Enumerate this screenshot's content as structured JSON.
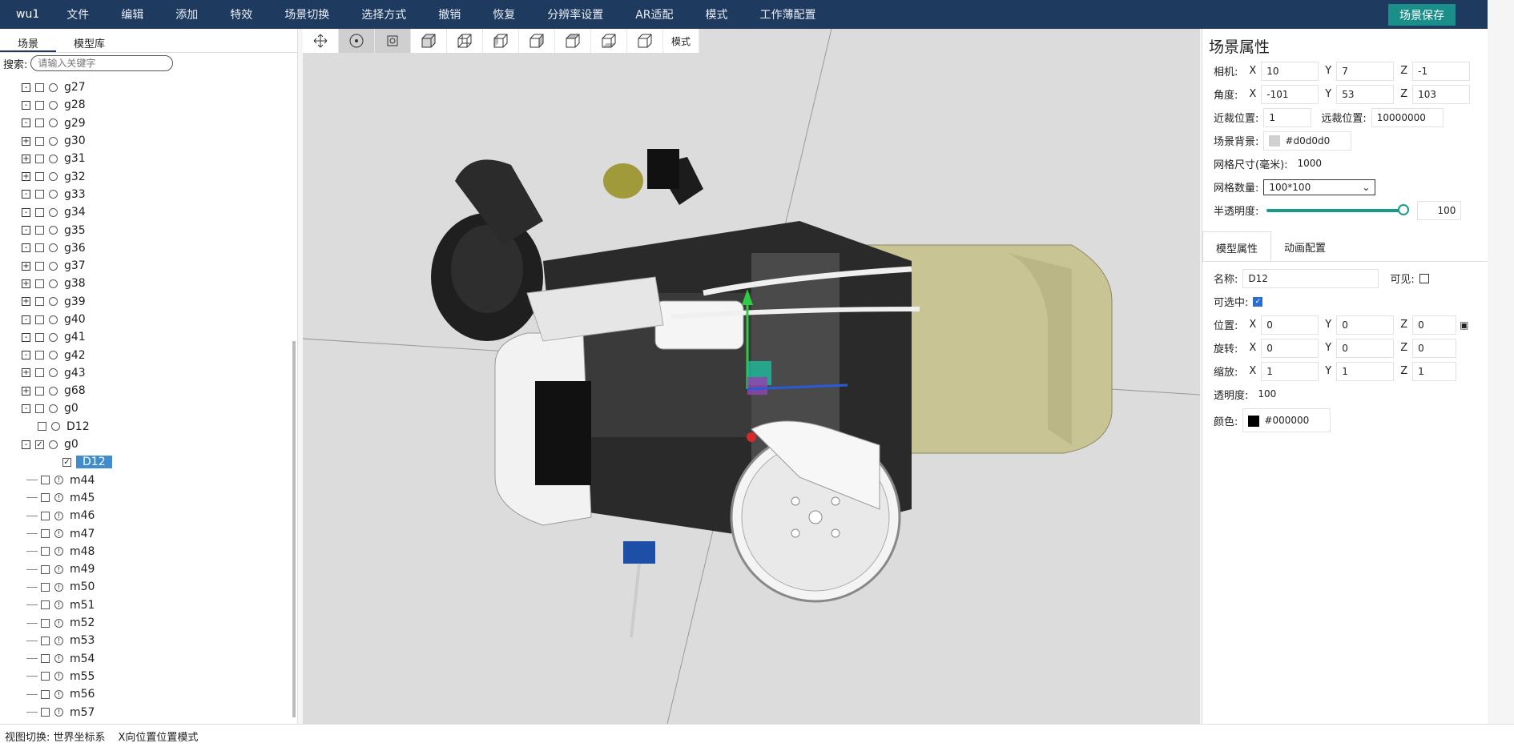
{
  "app": {
    "name": "wu1"
  },
  "menu": {
    "items": [
      "文件",
      "编辑",
      "添加",
      "特效",
      "场景切换",
      "选择方式",
      "撤销",
      "恢复",
      "分辨率设置",
      "AR适配",
      "模式",
      "工作薄配置"
    ],
    "save_label": "场景保存"
  },
  "left": {
    "tabs": [
      "场景",
      "模型库"
    ],
    "search": {
      "label": "搜索:",
      "placeholder": "请输入关键字"
    },
    "tree": [
      {
        "label": "g27",
        "kind": "group",
        "expand": "-"
      },
      {
        "label": "g28",
        "kind": "group",
        "expand": "-"
      },
      {
        "label": "g29",
        "kind": "group",
        "expand": "-"
      },
      {
        "label": "g30",
        "kind": "group",
        "expand": "+"
      },
      {
        "label": "g31",
        "kind": "group",
        "expand": "+"
      },
      {
        "label": "g32",
        "kind": "group",
        "expand": "+"
      },
      {
        "label": "g33",
        "kind": "group",
        "expand": "-"
      },
      {
        "label": "g34",
        "kind": "group",
        "expand": "-"
      },
      {
        "label": "g35",
        "kind": "group",
        "expand": "-"
      },
      {
        "label": "g36",
        "kind": "group",
        "expand": "-"
      },
      {
        "label": "g37",
        "kind": "group",
        "expand": "+"
      },
      {
        "label": "g38",
        "kind": "group",
        "expand": "+"
      },
      {
        "label": "g39",
        "kind": "group",
        "expand": "+"
      },
      {
        "label": "g40",
        "kind": "group",
        "expand": "-"
      },
      {
        "label": "g41",
        "kind": "group",
        "expand": "-"
      },
      {
        "label": "g42",
        "kind": "group",
        "expand": "-"
      },
      {
        "label": "g43",
        "kind": "group",
        "expand": "+"
      },
      {
        "label": "g68",
        "kind": "group",
        "expand": "+"
      },
      {
        "label": "g0",
        "kind": "group",
        "expand": "-"
      },
      {
        "label": "D12",
        "kind": "child"
      },
      {
        "label": "g0",
        "kind": "group",
        "expand": "-",
        "checked": true
      },
      {
        "label": "D12",
        "kind": "child",
        "selected": true,
        "checked": true
      },
      {
        "label": "m44",
        "kind": "mesh"
      },
      {
        "label": "m45",
        "kind": "mesh"
      },
      {
        "label": "m46",
        "kind": "mesh"
      },
      {
        "label": "m47",
        "kind": "mesh"
      },
      {
        "label": "m48",
        "kind": "mesh"
      },
      {
        "label": "m49",
        "kind": "mesh"
      },
      {
        "label": "m50",
        "kind": "mesh"
      },
      {
        "label": "m51",
        "kind": "mesh"
      },
      {
        "label": "m52",
        "kind": "mesh"
      },
      {
        "label": "m53",
        "kind": "mesh"
      },
      {
        "label": "m54",
        "kind": "mesh"
      },
      {
        "label": "m55",
        "kind": "mesh"
      },
      {
        "label": "m56",
        "kind": "mesh"
      },
      {
        "label": "m57",
        "kind": "mesh"
      }
    ]
  },
  "toolbar": {
    "icons": [
      "move-icon",
      "rotate-icon",
      "scale-icon",
      "view-front-icon",
      "view-back-icon",
      "view-left-icon",
      "view-right-icon",
      "view-top-icon",
      "view-bottom-icon"
    ],
    "mode_label": "模式"
  },
  "right": {
    "title": "场景属性",
    "camera": {
      "label": "相机:",
      "x": "10",
      "y": "7",
      "z": "-1"
    },
    "angle": {
      "label": "角度:",
      "x": "-101",
      "y": "53",
      "z": "103"
    },
    "near": {
      "label": "近裁位置:",
      "value": "1"
    },
    "far": {
      "label": "远裁位置:",
      "value": "10000000"
    },
    "bg": {
      "label": "场景背景:",
      "value": "#d0d0d0",
      "color": "#d0d0d0"
    },
    "grid_size": {
      "label": "网格尺寸(毫米):",
      "value": "1000"
    },
    "grid_count": {
      "label": "网格数量:",
      "value": "100*100"
    },
    "opacity_scene": {
      "label": "半透明度:",
      "value": "100",
      "level": 1.0
    },
    "tabs": [
      "模型属性",
      "动画配置"
    ],
    "name": {
      "label": "名称:",
      "value": "D12"
    },
    "visible": {
      "label": "可见:"
    },
    "selectable": {
      "label": "可选中:"
    },
    "position": {
      "label": "位置:",
      "x": "0",
      "y": "0",
      "z": "0"
    },
    "rotation": {
      "label": "旋转:",
      "x": "0",
      "y": "0",
      "z": "0"
    },
    "scale": {
      "label": "缩放:",
      "x": "1",
      "y": "1",
      "z": "1"
    },
    "transparency": {
      "label": "透明度:",
      "value": "100"
    },
    "color": {
      "label": "颜色:",
      "value": "#000000",
      "color": "#000000"
    }
  },
  "axis_labels": {
    "x": "X",
    "y": "Y",
    "z": "Z"
  },
  "status": {
    "left": "视图切换: 世界坐标系",
    "right": "X向位置位置模式"
  }
}
